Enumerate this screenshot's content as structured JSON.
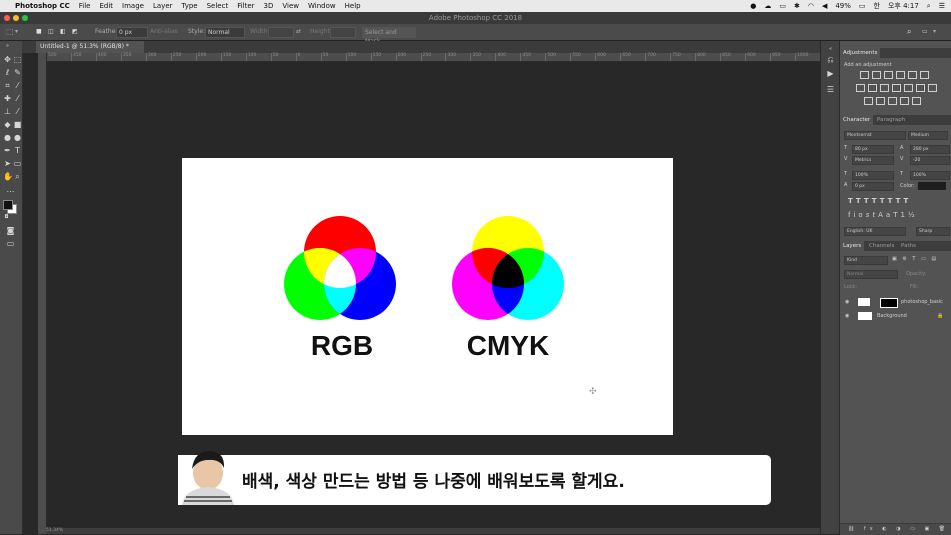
{
  "menubar": {
    "app_name": "Photoshop CC",
    "items": [
      "File",
      "Edit",
      "Image",
      "Layer",
      "Type",
      "Select",
      "Filter",
      "3D",
      "View",
      "Window",
      "Help"
    ],
    "battery": "49%",
    "status_text": "오후 4:17"
  },
  "window": {
    "title": "Adobe Photoshop CC 2018"
  },
  "options_bar": {
    "feather_label": "Feather:",
    "feather_value": "0 px",
    "anti_alias_label": "Anti-alias",
    "style_label": "Style:",
    "style_value": "Normal",
    "width_label": "Width:",
    "height_label": "Height:",
    "select_mask_label": "Select and Mask..."
  },
  "document": {
    "tab_title": "Untitled-1 @ 51.3% (RGB/8) *",
    "ruler_labels": [
      "500",
      "450",
      "400",
      "350",
      "300",
      "250",
      "200",
      "150",
      "100",
      "50",
      "0",
      "50",
      "100",
      "150",
      "200",
      "250",
      "300",
      "350",
      "400",
      "450",
      "500",
      "550",
      "600",
      "650",
      "700",
      "750",
      "800",
      "850",
      "900",
      "950",
      "1000"
    ],
    "canvas": {
      "rgb_label": "RGB",
      "cmyk_label": "CMYK",
      "colors": {
        "red": "#ff0000",
        "green": "#00ff00",
        "blue": "#0000ff",
        "yellow": "#ffff00",
        "magenta": "#ff00ff",
        "cyan": "#00ffff",
        "white": "#ffffff",
        "black": "#000000"
      }
    }
  },
  "panels": {
    "adjustments_tab": "Adjustments",
    "add_adjustment_label": "Add an adjustment",
    "character_tab": "Character",
    "paragraph_tab": "Paragraph",
    "font_family": "Montserrat",
    "font_style": "Medium",
    "font_size": "80 px",
    "leading": "280 px",
    "kerning": "Metrics",
    "tracking": "-20",
    "vertical_scale": "100%",
    "horizontal_scale": "100%",
    "baseline_shift": "0 px",
    "color_label": "Color:",
    "language": "English: UK",
    "anti_alias": "Sharp",
    "layers_tab": "Layers",
    "channels_tab": "Channels",
    "paths_tab": "Paths",
    "kind_label": "Kind",
    "blend_mode": "Normal",
    "opacity_label": "Opacity:",
    "fill_label": "Fill:",
    "lock_label": "Lock:",
    "layers": [
      {
        "name": "photoshop_basic"
      },
      {
        "name": "Background"
      }
    ]
  },
  "subtitle": {
    "text": "배색, 색상 만드는 방법 등 나중에 배워보도록 할게요."
  },
  "status": {
    "zoom": "51.34%"
  }
}
